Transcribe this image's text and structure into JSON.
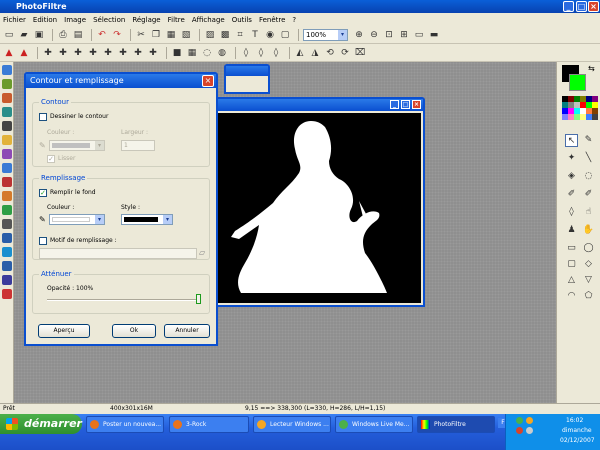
{
  "app": {
    "title": "PhotoFiltre"
  },
  "menu": [
    "Fichier",
    "Edition",
    "Image",
    "Sélection",
    "Réglage",
    "Filtre",
    "Affichage",
    "Outils",
    "Fenêtre",
    "?"
  ],
  "toolbar": {
    "zoom": "100%"
  },
  "doc_window": {
    "title": "3"
  },
  "dialog": {
    "title": "Contour et remplissage",
    "contour_group": "Contour",
    "draw_contour": "Dessiner le contour",
    "color_label": "Couleur :",
    "width_label": "Largeur :",
    "width_value": "1",
    "smooth_label": "Lisser",
    "fill_group": "Remplissage",
    "fill_bg": "Remplir le fond",
    "fill_color_label": "Couleur :",
    "style_label": "Style :",
    "pattern_label": "Motif de remplissage :",
    "attenuate_group": "Atténuer",
    "opacity_label": "Opacité : 100%",
    "preview_btn": "Aperçu",
    "ok_btn": "Ok",
    "cancel_btn": "Annuler"
  },
  "status": {
    "ready": "Prêt",
    "size": "400x301x16M",
    "coords": "9,15 ==> 338,300 (L=330, H=286, L/H=1,15)"
  },
  "taskbar": {
    "start": "démarrer",
    "tasks": [
      "Poster un nouvea...",
      "3-Rock",
      "Lecteur Windows ...",
      "Windows Live Me...",
      "PhotoFiltre"
    ],
    "lang": "FR",
    "time": "16:02",
    "day": "dimanche",
    "date": "02/12/2007"
  },
  "colors": {
    "accent": "#0a4fd0",
    "foreground": "#000000",
    "background": "#00ff00"
  }
}
